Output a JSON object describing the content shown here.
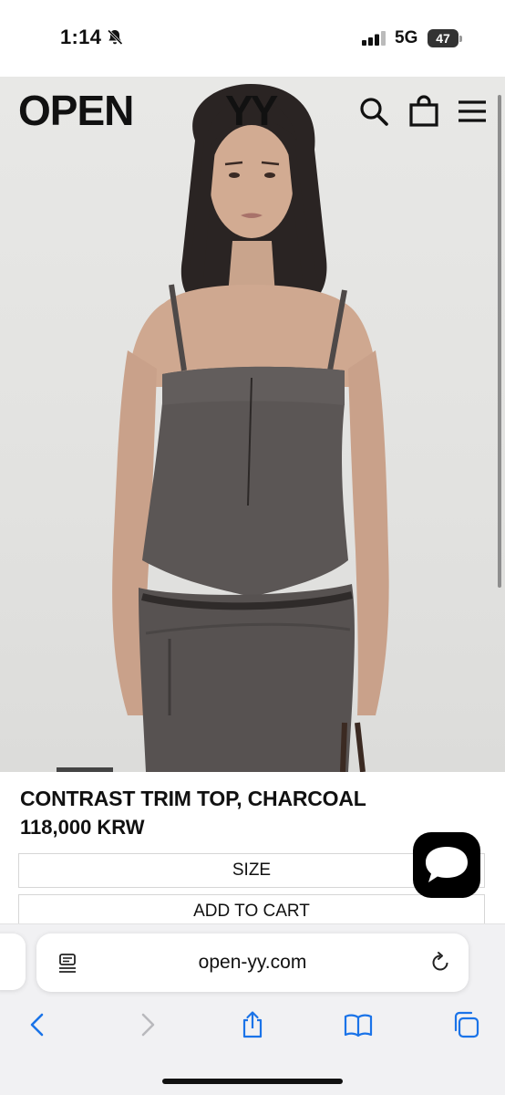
{
  "status_bar": {
    "time": "1:14",
    "network": "5G",
    "battery": "47"
  },
  "site_header": {
    "brand_left": "OPEN",
    "brand_right": "YY"
  },
  "product": {
    "title": "CONTRAST TRIM TOP, CHARCOAL",
    "price": "118,000 KRW",
    "size_label": "SIZE",
    "add_to_cart_label": "ADD TO CART"
  },
  "browser": {
    "url": "open-yy.com"
  },
  "icons": {
    "silent": "bell-slash-icon",
    "signal": "cellular-signal-icon",
    "search": "search-icon",
    "bag": "shopping-bag-icon",
    "menu": "hamburger-menu-icon",
    "chat": "chat-bubble-icon",
    "reader": "reader-mode-icon",
    "reload": "reload-icon",
    "back": "chevron-left-icon",
    "forward": "chevron-right-icon",
    "share": "share-icon",
    "bookmarks": "book-icon",
    "tabs": "tabs-icon"
  },
  "colors": {
    "garment": "#5b5655",
    "background": "#e6e6e4",
    "chat_button": "#000000",
    "link_blue": "#1a73e8"
  }
}
